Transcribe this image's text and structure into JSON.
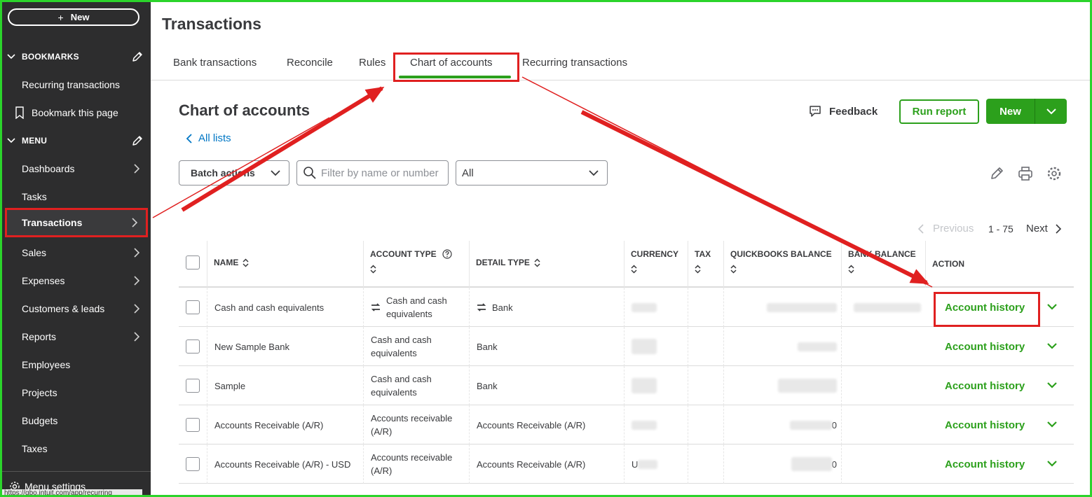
{
  "sidebar": {
    "new_label": "New",
    "bookmarks_header": "BOOKMARKS",
    "bookmarks": [
      {
        "label": "Recurring transactions"
      },
      {
        "label": "Bookmark this page"
      }
    ],
    "menu_header": "MENU",
    "menu_items": [
      {
        "label": "Dashboards",
        "has_arrow": true
      },
      {
        "label": "Tasks",
        "has_arrow": false
      },
      {
        "label": "Transactions",
        "has_arrow": true,
        "active": true
      },
      {
        "label": "Sales",
        "has_arrow": true
      },
      {
        "label": "Expenses",
        "has_arrow": true
      },
      {
        "label": "Customers & leads",
        "has_arrow": true
      },
      {
        "label": "Reports",
        "has_arrow": true
      },
      {
        "label": "Employees",
        "has_arrow": false
      },
      {
        "label": "Projects",
        "has_arrow": false
      },
      {
        "label": "Budgets",
        "has_arrow": false
      },
      {
        "label": "Taxes",
        "has_arrow": false
      }
    ],
    "menu_settings": "Menu settings",
    "status_url": "https://qbo.intuit.com/app/recurring"
  },
  "header": {
    "title": "Transactions",
    "tabs": [
      {
        "label": "Bank transactions"
      },
      {
        "label": "Reconcile"
      },
      {
        "label": "Rules"
      },
      {
        "label": "Chart of accounts",
        "active": true
      },
      {
        "label": "Recurring transactions"
      }
    ]
  },
  "page": {
    "title": "Chart of accounts",
    "all_lists": "All lists",
    "feedback": "Feedback",
    "run_report": "Run report",
    "new_label": "New",
    "batch_actions": "Batch actions",
    "search_placeholder": "Filter by name or number",
    "filter_value": "All",
    "pager": {
      "previous": "Previous",
      "range": "1 - 75",
      "next": "Next"
    }
  },
  "table": {
    "columns": {
      "name": "NAME",
      "account_type": "ACCOUNT TYPE",
      "detail_type": "DETAIL TYPE",
      "currency": "CURRENCY",
      "tax": "TAX",
      "qb_balance": "QUICKBOOKS BALANCE",
      "bank_balance": "BANK BALANCE",
      "action": "ACTION"
    },
    "rows": [
      {
        "name": "Cash and cash equivalents",
        "account_type": "Cash and cash equivalents",
        "detail_type": "Bank",
        "action": "Account history"
      },
      {
        "name": "New Sample Bank",
        "account_type": "Cash and cash equivalents",
        "detail_type": "Bank",
        "action": "Account history"
      },
      {
        "name": "Sample",
        "account_type": "Cash and cash equivalents",
        "detail_type": "Bank",
        "action": "Account history"
      },
      {
        "name": "Accounts Receivable (A/R)",
        "account_type": "Accounts receivable (A/R)",
        "detail_type": "Accounts Receivable (A/R)",
        "qb_suffix": "0",
        "action": "Account history"
      },
      {
        "name": "Accounts Receivable (A/R) - USD",
        "account_type": "Accounts receivable (A/R)",
        "detail_type": "Accounts Receivable (A/R)",
        "currency_prefix": "U",
        "qb_suffix": "0",
        "action": "Account history"
      }
    ]
  },
  "colors": {
    "sidebar_bg": "#2d2d2e",
    "brand_green": "#2ca01c",
    "link_blue": "#0077c5",
    "annotation_red": "#e02020",
    "frame_green": "#2bd42b"
  }
}
